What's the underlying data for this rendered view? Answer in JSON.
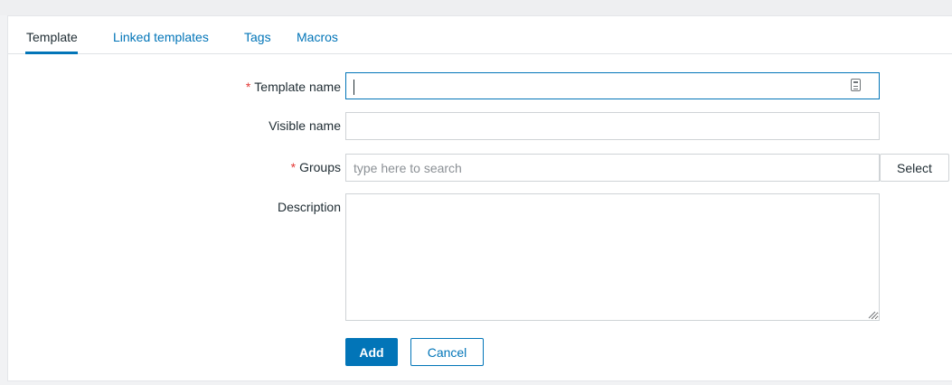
{
  "tabs": [
    {
      "label": "Template",
      "active": true
    },
    {
      "label": "Linked templates",
      "active": false
    },
    {
      "label": "Tags",
      "active": false
    },
    {
      "label": "Macros",
      "active": false
    }
  ],
  "form": {
    "template_name": {
      "required_mark": "*",
      "label": "Template name",
      "value": "",
      "icon": "autofill-icon"
    },
    "visible_name": {
      "label": "Visible name",
      "value": ""
    },
    "groups": {
      "required_mark": "*",
      "label": "Groups",
      "placeholder": "type here to search",
      "select_label": "Select"
    },
    "description": {
      "label": "Description",
      "value": ""
    }
  },
  "actions": {
    "add_label": "Add",
    "cancel_label": "Cancel"
  },
  "colors": {
    "accent": "#0275b8",
    "required": "#e33734",
    "text": "#1f2c33",
    "border": "#cfd3d6",
    "background": "#f1f2f4"
  }
}
